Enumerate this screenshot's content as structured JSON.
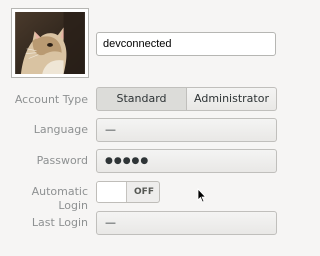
{
  "user": {
    "username": "devconnected",
    "avatar_icon": "user-avatar-cat-photo"
  },
  "account_type": {
    "label": "Account Type",
    "options": [
      "Standard",
      "Administrator"
    ],
    "selected": "Standard"
  },
  "language": {
    "label": "Language",
    "value": "—"
  },
  "password": {
    "label": "Password",
    "value": "●●●●●"
  },
  "automatic_login": {
    "label": "Automatic Login",
    "state_text": "OFF"
  },
  "last_login": {
    "label": "Last Login",
    "value": "—"
  },
  "colors": {
    "background": "#f6f5f4",
    "label_gray": "#8e9192",
    "border": "#c0bfbc"
  }
}
